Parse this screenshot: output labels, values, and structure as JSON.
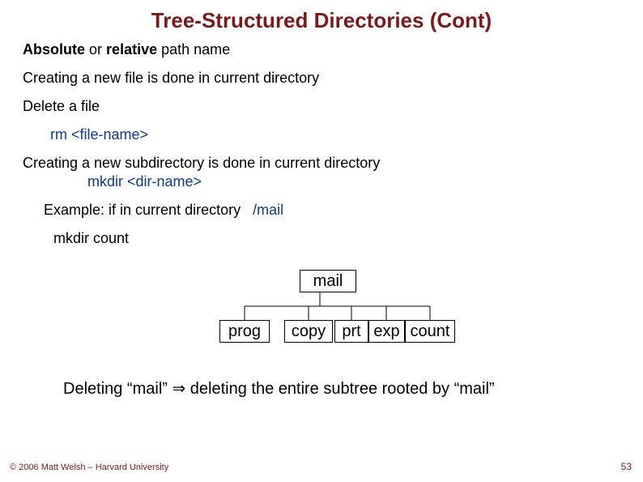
{
  "title": "Tree-Structured Directories (Cont)",
  "lines": {
    "pathname": "Absolute or relative path name",
    "newfile": "Creating a new file is done in current directory",
    "deletefile": "Delete a file",
    "rm": "rm <file-name>",
    "newsubdir": "Creating a new subdirectory is done in current directory",
    "mkdir": "mkdir <dir-name>",
    "example_prefix": "Example:  if in current directory",
    "example_path": "/mail",
    "mkdir_count": "mkdir count",
    "ending": "Deleting “mail” ⇒ deleting the entire subtree rooted by “mail”"
  },
  "tree": {
    "root": "mail",
    "children": [
      "prog",
      "copy",
      "prt",
      "exp",
      "count"
    ]
  },
  "footer": {
    "copyright": "© 2006 Matt Welsh – Harvard University",
    "page": "53"
  }
}
